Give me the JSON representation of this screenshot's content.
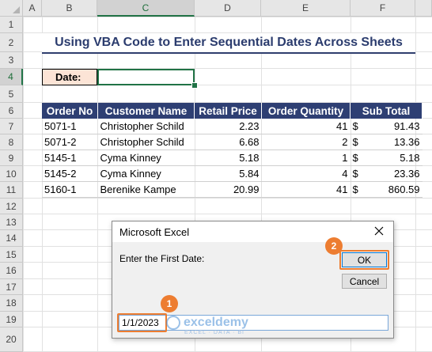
{
  "columns": [
    "A",
    "B",
    "C",
    "D",
    "E",
    "F"
  ],
  "rows": [
    "1",
    "2",
    "3",
    "4",
    "5",
    "6",
    "7",
    "8",
    "9",
    "10",
    "11",
    "12",
    "13",
    "14",
    "15",
    "16",
    "17",
    "18",
    "19",
    "20"
  ],
  "title": "Using VBA Code to Enter Sequential Dates Across Sheets",
  "date_label": "Date:",
  "table": {
    "headers": [
      "Order No",
      "Customer Name",
      "Retail Price",
      "Order Quantity",
      "Sub Total"
    ],
    "rows": [
      {
        "order": "5071-1",
        "customer": "Christopher Schild",
        "price": "2.23",
        "qty": "41",
        "currency": "$",
        "subtotal": "91.43"
      },
      {
        "order": "5071-2",
        "customer": "Christopher Schild",
        "price": "6.68",
        "qty": "2",
        "currency": "$",
        "subtotal": "13.36"
      },
      {
        "order": "5145-1",
        "customer": "Cyma Kinney",
        "price": "5.18",
        "qty": "1",
        "currency": "$",
        "subtotal": "5.18"
      },
      {
        "order": "5145-2",
        "customer": "Cyma Kinney",
        "price": "5.84",
        "qty": "4",
        "currency": "$",
        "subtotal": "23.36"
      },
      {
        "order": "5160-1",
        "customer": "Berenike Kampe",
        "price": "20.99",
        "qty": "41",
        "currency": "$",
        "subtotal": "860.59"
      }
    ]
  },
  "dialog": {
    "title": "Microsoft Excel",
    "prompt": "Enter the First Date:",
    "ok_label": "OK",
    "cancel_label": "Cancel",
    "input_value": "1/1/2023",
    "close_icon": "close-icon"
  },
  "badges": {
    "one": "1",
    "two": "2"
  },
  "watermark": {
    "name": "exceldemy",
    "tagline": "EXCEL · DATA · BI"
  },
  "colors": {
    "header_bg": "#2e3f73",
    "title_text": "#2b3c6e",
    "date_label_bg": "#fce4d6",
    "accent_orange": "#ed7d31",
    "excel_green": "#217346"
  }
}
